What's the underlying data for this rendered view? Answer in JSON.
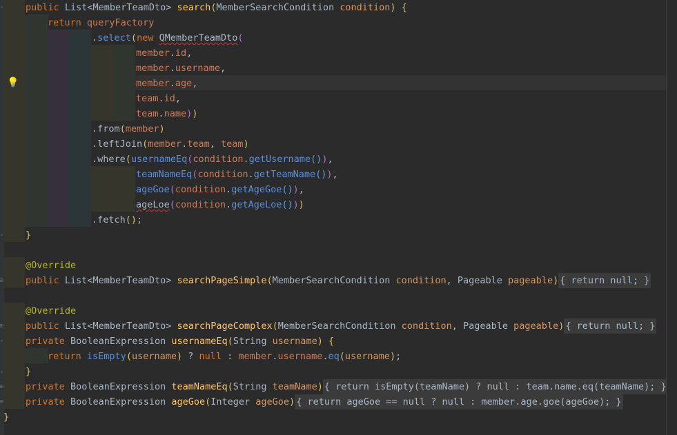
{
  "editor": {
    "language": "Java",
    "caret_line": 6
  },
  "code_lines": [
    [
      [
        "kw",
        "public "
      ],
      [
        "typ",
        "List<MemberTeamDto> "
      ],
      [
        "fn",
        "search"
      ],
      [
        "br1",
        "("
      ],
      [
        "typ",
        "MemberSearchCondition "
      ],
      [
        "param",
        "condition"
      ],
      [
        "br1",
        ") "
      ],
      [
        "br1",
        "{"
      ]
    ],
    [
      [
        "kw",
        "return "
      ],
      [
        "field",
        "queryFactory"
      ]
    ],
    [
      [
        "plain",
        "."
      ],
      [
        "call",
        "select"
      ],
      [
        "br1",
        "("
      ],
      [
        "kw",
        "new "
      ],
      [
        "sq",
        "QMemberTeamDto"
      ],
      [
        "br2",
        "("
      ]
    ],
    [
      [
        "field",
        "member"
      ],
      [
        "plain",
        "."
      ],
      [
        "field",
        "id"
      ],
      [
        "plain",
        ","
      ]
    ],
    [
      [
        "field",
        "member"
      ],
      [
        "plain",
        "."
      ],
      [
        "field",
        "username"
      ],
      [
        "plain",
        ","
      ]
    ],
    [
      [
        "field",
        "member"
      ],
      [
        "plain",
        "."
      ],
      [
        "field",
        "age"
      ],
      [
        "plain",
        ","
      ]
    ],
    [
      [
        "field",
        "team"
      ],
      [
        "plain",
        "."
      ],
      [
        "field",
        "id"
      ],
      [
        "plain",
        ","
      ]
    ],
    [
      [
        "field",
        "team"
      ],
      [
        "plain",
        "."
      ],
      [
        "field",
        "name"
      ],
      [
        "br2",
        ")"
      ],
      [
        "br1",
        ")"
      ]
    ],
    [
      [
        "plain",
        ".from"
      ],
      [
        "br1",
        "("
      ],
      [
        "field",
        "member"
      ],
      [
        "br1",
        ")"
      ]
    ],
    [
      [
        "plain",
        ".leftJoin"
      ],
      [
        "br1",
        "("
      ],
      [
        "field",
        "member"
      ],
      [
        "plain",
        "."
      ],
      [
        "field",
        "team"
      ],
      [
        "plain",
        ", "
      ],
      [
        "field",
        "team"
      ],
      [
        "br1",
        ")"
      ]
    ],
    [
      [
        "plain",
        ".where"
      ],
      [
        "br1",
        "("
      ],
      [
        "call",
        "usernameEq"
      ],
      [
        "br2",
        "("
      ],
      [
        "field",
        "condition"
      ],
      [
        "plain",
        "."
      ],
      [
        "call",
        "getUsername"
      ],
      [
        "br3",
        "()"
      ],
      [
        "br2",
        ")"
      ],
      [
        "plain",
        ","
      ]
    ],
    [
      [
        "call",
        "teamNameEq"
      ],
      [
        "br2",
        "("
      ],
      [
        "field",
        "condition"
      ],
      [
        "plain",
        "."
      ],
      [
        "call",
        "getTeamName"
      ],
      [
        "br3",
        "()"
      ],
      [
        "br2",
        ")"
      ],
      [
        "plain",
        ","
      ]
    ],
    [
      [
        "call",
        "ageGoe"
      ],
      [
        "br2",
        "("
      ],
      [
        "field",
        "condition"
      ],
      [
        "plain",
        "."
      ],
      [
        "call",
        "getAgeGoe"
      ],
      [
        "br3",
        "()"
      ],
      [
        "br2",
        ")"
      ],
      [
        "plain",
        ","
      ]
    ],
    [
      [
        "sqp",
        "ageLoe"
      ],
      [
        "br2",
        "("
      ],
      [
        "field",
        "condition"
      ],
      [
        "plain",
        "."
      ],
      [
        "call",
        "getAgeLoe"
      ],
      [
        "br3",
        "()"
      ],
      [
        "br2",
        ")"
      ],
      [
        "br1",
        ")"
      ]
    ],
    [
      [
        "plain",
        ".fetch"
      ],
      [
        "br1",
        "()"
      ],
      [
        "plain",
        ";"
      ]
    ],
    [
      [
        "br1",
        "}"
      ]
    ],
    [],
    [
      [
        "ann",
        "@Override"
      ]
    ],
    [
      [
        "kw",
        "public "
      ],
      [
        "typ",
        "List<MemberTeamDto> "
      ],
      [
        "fn",
        "searchPageSimple"
      ],
      [
        "br1",
        "("
      ],
      [
        "typ",
        "MemberSearchCondition "
      ],
      [
        "param",
        "condition"
      ],
      [
        "plain",
        ", "
      ],
      [
        "typ",
        "Pageable "
      ],
      [
        "param",
        "pageable"
      ],
      [
        "br1",
        ")"
      ],
      [
        "fold",
        "{ return null; }"
      ]
    ],
    [],
    [
      [
        "ann",
        "@Override"
      ]
    ],
    [
      [
        "kw",
        "public "
      ],
      [
        "typ",
        "List<MemberTeamDto> "
      ],
      [
        "fn",
        "searchPageComplex"
      ],
      [
        "br1",
        "("
      ],
      [
        "typ",
        "MemberSearchCondition "
      ],
      [
        "param",
        "condition"
      ],
      [
        "plain",
        ", "
      ],
      [
        "typ",
        "Pageable "
      ],
      [
        "param",
        "pageable"
      ],
      [
        "br1",
        ")"
      ],
      [
        "fold",
        "{ return null; }"
      ]
    ],
    [
      [
        "kw",
        "private "
      ],
      [
        "typ",
        "BooleanExpression "
      ],
      [
        "fn",
        "usernameEq"
      ],
      [
        "br1",
        "("
      ],
      [
        "typ",
        "String "
      ],
      [
        "param",
        "username"
      ],
      [
        "br1",
        ") {"
      ]
    ],
    [
      [
        "kw",
        "return "
      ],
      [
        "call",
        "isEmpty"
      ],
      [
        "br1",
        "("
      ],
      [
        "param",
        "username"
      ],
      [
        "br1",
        ")"
      ],
      [
        "plain",
        " ? "
      ],
      [
        "kw",
        "null"
      ],
      [
        "plain",
        " : "
      ],
      [
        "field",
        "member"
      ],
      [
        "plain",
        "."
      ],
      [
        "field",
        "username"
      ],
      [
        "plain",
        "."
      ],
      [
        "call",
        "eq"
      ],
      [
        "br1",
        "("
      ],
      [
        "param",
        "username"
      ],
      [
        "br1",
        ")"
      ],
      [
        "plain",
        ";"
      ]
    ],
    [
      [
        "br1",
        "}"
      ]
    ],
    [
      [
        "kw",
        "private "
      ],
      [
        "typ",
        "BooleanExpression "
      ],
      [
        "fn",
        "teamNameEq"
      ],
      [
        "br1",
        "("
      ],
      [
        "typ",
        "String "
      ],
      [
        "param",
        "teamName"
      ],
      [
        "br1",
        ")"
      ],
      [
        "fold",
        "{ return isEmpty(teamName) ? null : team.name.eq(teamName); }"
      ]
    ],
    [
      [
        "kw",
        "private "
      ],
      [
        "typ",
        "BooleanExpression "
      ],
      [
        "fn",
        "ageGoe"
      ],
      [
        "br1",
        "("
      ],
      [
        "typ",
        "Integer "
      ],
      [
        "param",
        "ageGoe"
      ],
      [
        "br1",
        ")"
      ],
      [
        "fold",
        "{ return ageGoe == null ? null : member.age.goe(ageGoe); }"
      ]
    ],
    [
      [
        "br1",
        "}"
      ]
    ]
  ]
}
